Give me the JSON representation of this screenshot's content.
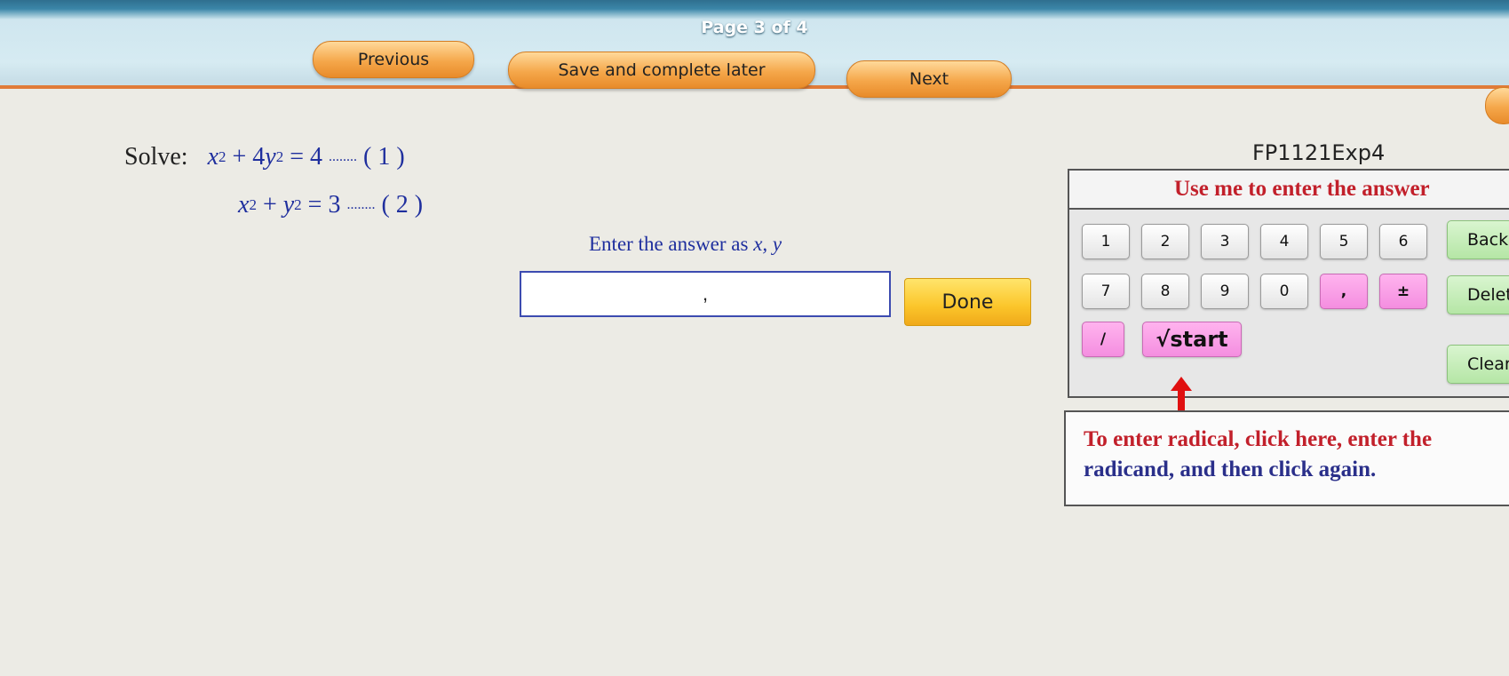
{
  "header": {
    "page_indicator": "Page 3 of 4",
    "previous_label": "Previous",
    "save_label": "Save and complete later",
    "next_label": "Next"
  },
  "problem": {
    "solve_label": "Solve:",
    "equations": [
      {
        "lhs_a": "x",
        "exp_a": "2",
        "op": " + ",
        "coef": "4",
        "lhs_b": "y",
        "exp_b": "2",
        "rhs": " = 4 ",
        "dots": "........",
        "tag": " ( 1 )"
      },
      {
        "lhs_a": "x",
        "exp_a": "2",
        "op": " + ",
        "coef": "",
        "lhs_b": "y",
        "exp_b": "2",
        "rhs": " = 3 ",
        "dots": "........",
        "tag": " ( 2 )"
      }
    ]
  },
  "answer": {
    "prompt_text": "Enter the answer as ",
    "prompt_vars": "x, y",
    "input_value": ",",
    "done_label": "Done"
  },
  "keypad": {
    "problem_code": "FP1121Exp4",
    "title": "Use me to enter the answer",
    "row1": [
      "1",
      "2",
      "3",
      "4",
      "5",
      "6"
    ],
    "row2": [
      "7",
      "8",
      "9",
      "0",
      ",",
      "±"
    ],
    "slash_key": "/",
    "sqrt_key": "√start",
    "back_label": "Back",
    "delete_label": "Delete",
    "clear_label": "Clear",
    "hint_line1": "To enter radical, click here, enter the",
    "hint_line2": "radicand, and then click again."
  },
  "colors": {
    "accent_orange": "#f5a74a",
    "equation_blue": "#1f2f9e",
    "title_red": "#c2202b",
    "pink_key": "#f48ee0",
    "green_key": "#b5e6a6"
  }
}
